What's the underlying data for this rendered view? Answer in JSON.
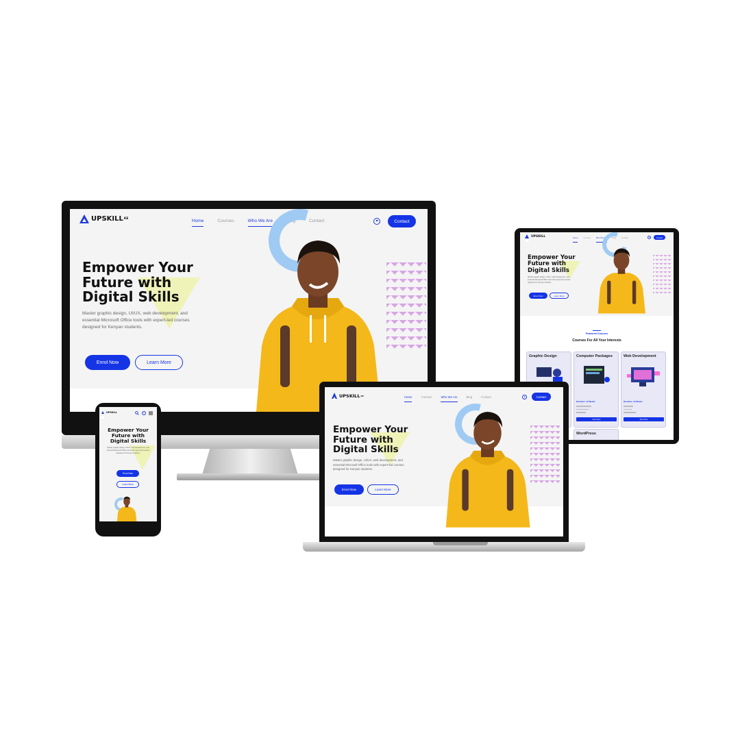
{
  "brand": {
    "name": "UPSKILL",
    "suffix": "KE"
  },
  "nav": {
    "home": "Home",
    "courses": "Courses",
    "who_we_are": "Who We Are",
    "blog": "Blog",
    "contact": "Contact",
    "contact_button": "Contact"
  },
  "hero": {
    "headline_1": "Empower Your",
    "headline_2": "Future with",
    "headline_3": "Digital Skills",
    "subtitle_1": "Master graphic design, UI/UX, web development, and",
    "subtitle_2": "essential Microsoft Office tools with expert-led courses",
    "subtitle_3": "designed for Kenyan students.",
    "enrol_label": "Enrol Now",
    "learn_label": "Learn More"
  },
  "featured": {
    "eyebrow": "Featured Courses",
    "title": "Courses For All Your Interests",
    "cards": [
      {
        "title": "Graphic Design"
      },
      {
        "title": "Computer Packages",
        "duration": "Duration: 12 Weeks",
        "button": "Enrol Now"
      },
      {
        "title": "Web Development",
        "duration": "Duration: 12 Weeks",
        "button": "Enrol Now"
      }
    ],
    "next_card": "WordPress"
  },
  "colors": {
    "accent": "#1434e6",
    "hoodie": "#f4b81a",
    "arc": "#9fcaf3",
    "zigzag": "#d8a6e6"
  }
}
